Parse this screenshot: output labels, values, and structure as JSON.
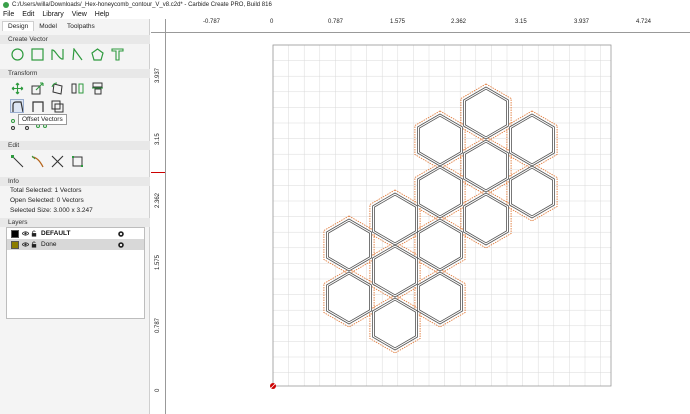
{
  "window": {
    "title": "C:/Users/willa/Downloads/_Hex-honeycomb_contour_V_v8.c2d* - Carbide Create PRO, Build 816"
  },
  "menu": [
    "File",
    "Edit",
    "Library",
    "View",
    "Help"
  ],
  "tabs": [
    {
      "label": "Design",
      "active": true
    },
    {
      "label": "Model",
      "active": false
    },
    {
      "label": "Toolpaths",
      "active": false
    }
  ],
  "sections": {
    "create_vector": "Create Vector",
    "transform": "Transform",
    "edit": "Edit",
    "info": "Info",
    "layers": "Layers"
  },
  "create_icons": [
    "circle-icon",
    "rectangle-icon",
    "curve-icon",
    "polyline-icon",
    "polygon-icon",
    "text-icon"
  ],
  "transform_icons": [
    "move-icon",
    "scale-icon",
    "rotate-icon",
    "mirror-icon",
    "align-icon"
  ],
  "transform_icons_row2": [
    "offset-vector-icon",
    "fillet-icon",
    "boolean-icon"
  ],
  "tooltip": "Offset Vectors",
  "edit_icons": [
    "node-edit-icon",
    "trim-icon",
    "cut-icon",
    "join-icon"
  ],
  "info": {
    "total_selected_label": "Total Selected:",
    "total_selected_value": "1 Vectors",
    "open_selected_label": "Open Selected:",
    "open_selected_value": "0 Vectors",
    "selected_size_label": "Selected Size:",
    "selected_size_value": "3.000 x 3.247"
  },
  "layers": [
    {
      "name": "DEFAULT",
      "color": "#000000",
      "bold": true,
      "selected": false
    },
    {
      "name": "Done",
      "color": "#8b7d00",
      "bold": false,
      "selected": true
    }
  ],
  "ruler_top": [
    "-0.787",
    "0",
    "0.787",
    "1.575",
    "2.362",
    "3.15",
    "3.937",
    "4.724"
  ],
  "ruler_left": [
    "3.937",
    "3.15",
    "2.362",
    "1.575",
    "0.787",
    "0"
  ],
  "colors": {
    "hex_stroke": "#555555",
    "offset_stroke": "#e07a3a",
    "grid": "#d9d9d9",
    "origin_marker": "#cc0000",
    "icon_green": "#2e9a3e"
  }
}
